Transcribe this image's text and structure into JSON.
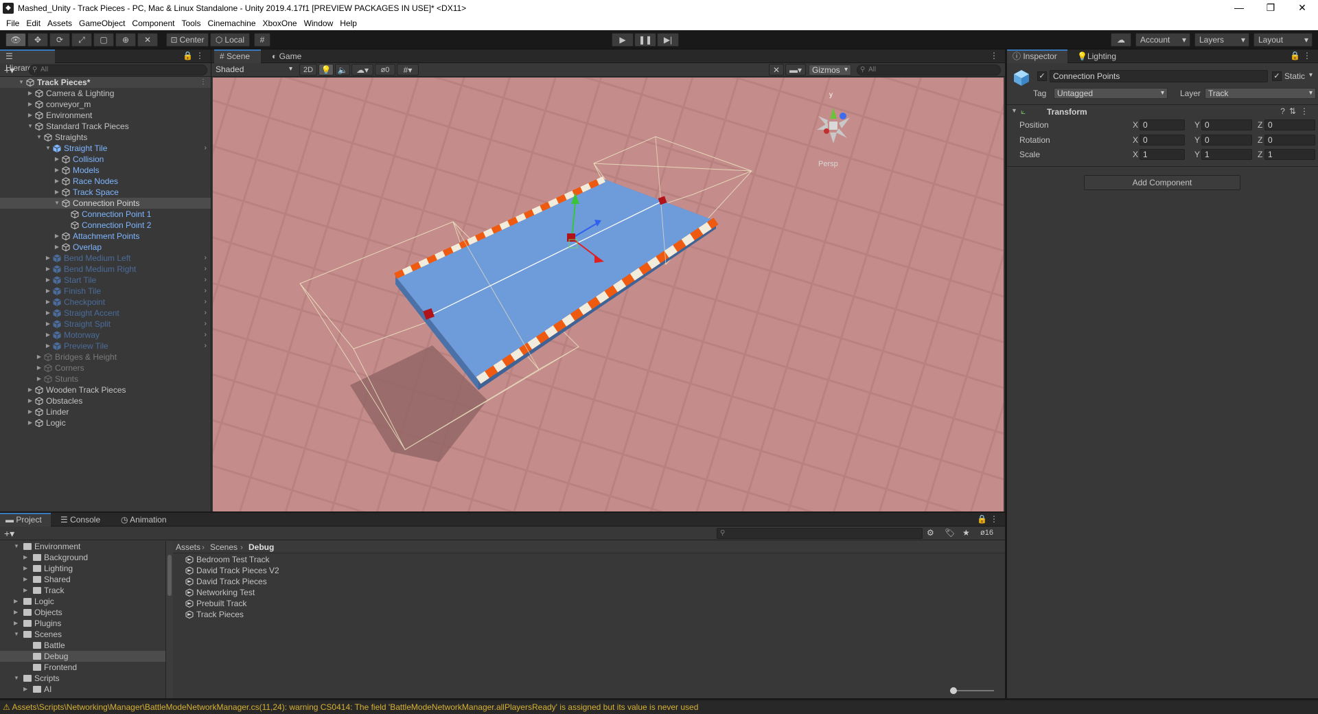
{
  "window": {
    "title": "Mashed_Unity - Track Pieces - PC, Mac & Linux Standalone - Unity 2019.4.17f1 [PREVIEW PACKAGES IN USE]* <DX11>",
    "minimize": "—",
    "maximize": "❐",
    "close": "✕"
  },
  "menu": [
    "File",
    "Edit",
    "Assets",
    "GameObject",
    "Component",
    "Tools",
    "Cinemachine",
    "XboxOne",
    "Window",
    "Help"
  ],
  "toolbar": {
    "pivot": "Center",
    "space": "Local",
    "account": "Account",
    "layers": "Layers",
    "layout": "Layout"
  },
  "hierarchy": {
    "tab": "Hierarchy",
    "search_placeholder": "All",
    "rows": [
      {
        "label": "Track Pieces*",
        "depth": 0,
        "arrow": "down",
        "style": "bold",
        "icon": "unity-icon"
      },
      {
        "label": "Camera & Lighting",
        "depth": 1,
        "arrow": "right",
        "style": "normal"
      },
      {
        "label": "conveyor_m",
        "depth": 1,
        "arrow": "right",
        "style": "normal"
      },
      {
        "label": "Environment",
        "depth": 1,
        "arrow": "right",
        "style": "normal"
      },
      {
        "label": "Standard Track Pieces",
        "depth": 1,
        "arrow": "down",
        "style": "normal"
      },
      {
        "label": "Straights",
        "depth": 2,
        "arrow": "down",
        "style": "normal"
      },
      {
        "label": "Straight Tile",
        "depth": 3,
        "arrow": "down",
        "style": "prefab",
        "chev": true
      },
      {
        "label": "Collision",
        "depth": 4,
        "arrow": "right",
        "style": "blue"
      },
      {
        "label": "Models",
        "depth": 4,
        "arrow": "right",
        "style": "blue"
      },
      {
        "label": "Race Nodes",
        "depth": 4,
        "arrow": "right",
        "style": "blue"
      },
      {
        "label": "Track Space",
        "depth": 4,
        "arrow": "right",
        "style": "blue"
      },
      {
        "label": "Connection Points",
        "depth": 4,
        "arrow": "down",
        "style": "selected"
      },
      {
        "label": "Connection Point 1",
        "depth": 5,
        "arrow": "",
        "style": "blue"
      },
      {
        "label": "Connection Point 2",
        "depth": 5,
        "arrow": "",
        "style": "blue"
      },
      {
        "label": "Attachment Points",
        "depth": 4,
        "arrow": "right",
        "style": "blue"
      },
      {
        "label": "Overlap",
        "depth": 4,
        "arrow": "right",
        "style": "blue"
      },
      {
        "label": "Bend Medium Left",
        "depth": 3,
        "arrow": "right",
        "style": "dimblue",
        "chev": true
      },
      {
        "label": "Bend Medium Right",
        "depth": 3,
        "arrow": "right",
        "style": "dimblue",
        "chev": true
      },
      {
        "label": "Start Tile",
        "depth": 3,
        "arrow": "right",
        "style": "dimblue",
        "chev": true
      },
      {
        "label": "Finish Tile",
        "depth": 3,
        "arrow": "right",
        "style": "dimblue",
        "chev": true
      },
      {
        "label": "Checkpoint",
        "depth": 3,
        "arrow": "right",
        "style": "dimblue",
        "chev": true
      },
      {
        "label": "Straight Accent",
        "depth": 3,
        "arrow": "right",
        "style": "dimblue",
        "chev": true
      },
      {
        "label": "Straight Split",
        "depth": 3,
        "arrow": "right",
        "style": "dimblue",
        "chev": true
      },
      {
        "label": "Motorway",
        "depth": 3,
        "arrow": "right",
        "style": "dimblue",
        "chev": true
      },
      {
        "label": "Preview Tile",
        "depth": 3,
        "arrow": "right",
        "style": "dimblue",
        "chev": true
      },
      {
        "label": "Bridges & Height",
        "depth": 2,
        "arrow": "right",
        "style": "dim"
      },
      {
        "label": "Corners",
        "depth": 2,
        "arrow": "right",
        "style": "dim"
      },
      {
        "label": "Stunts",
        "depth": 2,
        "arrow": "right",
        "style": "dim"
      },
      {
        "label": "Wooden Track Pieces",
        "depth": 1,
        "arrow": "right",
        "style": "normal"
      },
      {
        "label": "Obstacles",
        "depth": 1,
        "arrow": "right",
        "style": "normal"
      },
      {
        "label": "Linder",
        "depth": 1,
        "arrow": "right",
        "style": "normal"
      },
      {
        "label": "Logic",
        "depth": 1,
        "arrow": "right",
        "style": "normal"
      }
    ]
  },
  "scene": {
    "tab_scene": "Scene",
    "tab_game": "Game",
    "shading": "Shaded",
    "mode_2d": "2D",
    "hidden_count": "0",
    "gizmos": "Gizmos",
    "search_placeholder": "All",
    "axis_y": "y",
    "persp": "Persp",
    "colors": {
      "ground": "#c48c8a",
      "track": "#6e9bd9",
      "stripe_orange": "#ee5a10",
      "stripe_white": "#f2ecdc"
    }
  },
  "inspector": {
    "tab_inspector": "Inspector",
    "tab_lighting": "Lighting",
    "object_name": "Connection Points",
    "static_label": "Static",
    "tag_label": "Tag",
    "tag_value": "Untagged",
    "layer_label": "Layer",
    "layer_value": "Track",
    "transform_title": "Transform",
    "position_label": "Position",
    "rotation_label": "Rotation",
    "scale_label": "Scale",
    "axes": {
      "x": "X",
      "y": "Y",
      "z": "Z"
    },
    "position": {
      "x": "0",
      "y": "0",
      "z": "0"
    },
    "rotation": {
      "x": "0",
      "y": "0",
      "z": "0"
    },
    "scale": {
      "x": "1",
      "y": "1",
      "z": "1"
    },
    "add_component": "Add Component"
  },
  "project": {
    "tab_project": "Project",
    "tab_console": "Console",
    "tab_animation": "Animation",
    "hidden_count": "16",
    "breadcrumb": [
      "Assets",
      "Scenes",
      "Debug"
    ],
    "tree": [
      {
        "label": "Environment",
        "depth": 0,
        "arrow": "down"
      },
      {
        "label": "Background",
        "depth": 1,
        "arrow": "right"
      },
      {
        "label": "Lighting",
        "depth": 1,
        "arrow": "right"
      },
      {
        "label": "Shared",
        "depth": 1,
        "arrow": "right"
      },
      {
        "label": "Track",
        "depth": 1,
        "arrow": "right"
      },
      {
        "label": "Logic",
        "depth": 0,
        "arrow": "right"
      },
      {
        "label": "Objects",
        "depth": 0,
        "arrow": "right"
      },
      {
        "label": "Plugins",
        "depth": 0,
        "arrow": "right"
      },
      {
        "label": "Scenes",
        "depth": 0,
        "arrow": "down"
      },
      {
        "label": "Battle",
        "depth": 1,
        "arrow": ""
      },
      {
        "label": "Debug",
        "depth": 1,
        "arrow": "",
        "selected": true
      },
      {
        "label": "Frontend",
        "depth": 1,
        "arrow": ""
      },
      {
        "label": "Scripts",
        "depth": 0,
        "arrow": "down"
      },
      {
        "label": "AI",
        "depth": 1,
        "arrow": "right"
      }
    ],
    "files": [
      "Bedroom Test Track",
      "David Track Pieces V2",
      "David Track Pieces",
      "Networking Test",
      "Prebuilt Track",
      "Track Pieces"
    ]
  },
  "status": {
    "message": "Assets\\Scripts\\Networking\\Manager\\BattleModeNetworkManager.cs(11,24): warning CS0414: The field 'BattleModeNetworkManager.allPlayersReady' is assigned but its value is never used"
  }
}
